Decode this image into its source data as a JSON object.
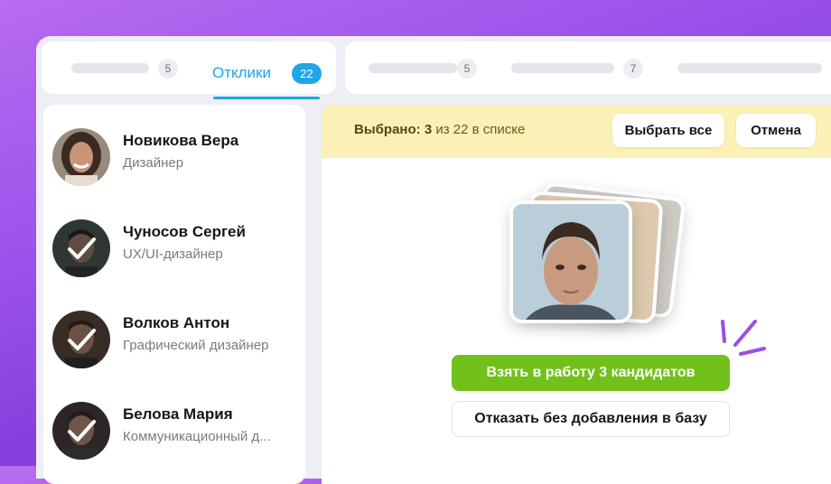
{
  "tabs_left": {
    "inactive_count": "5",
    "active_label": "Отклики",
    "active_count": "22"
  },
  "tabs_right": {
    "count_1": "5",
    "count_2": "7"
  },
  "candidates": [
    {
      "name": "Новикова Вера",
      "role": "Дизайнер",
      "selected": false
    },
    {
      "name": "Чуносов Сергей",
      "role": "UX/UI-дизайнер",
      "selected": true
    },
    {
      "name": "Волков Антон",
      "role": "Графический дизайнер",
      "selected": true
    },
    {
      "name": "Белова Мария",
      "role": "Коммуникационный д...",
      "selected": true
    }
  ],
  "selection_bar": {
    "prefix": "Выбрано:",
    "selected_count": "3",
    "suffix": "из 22 в списке",
    "select_all_label": "Выбрать все",
    "cancel_label": "Отмена"
  },
  "actions": {
    "take_label": "Взять в работу 3 кандидатов",
    "reject_label": "Отказать без добавления в базу"
  },
  "colors": {
    "accent_blue": "#1fa7e9",
    "primary_green": "#72c11b",
    "selection_bg": "#fbf0b5",
    "background_purple": "#8a46e0"
  }
}
